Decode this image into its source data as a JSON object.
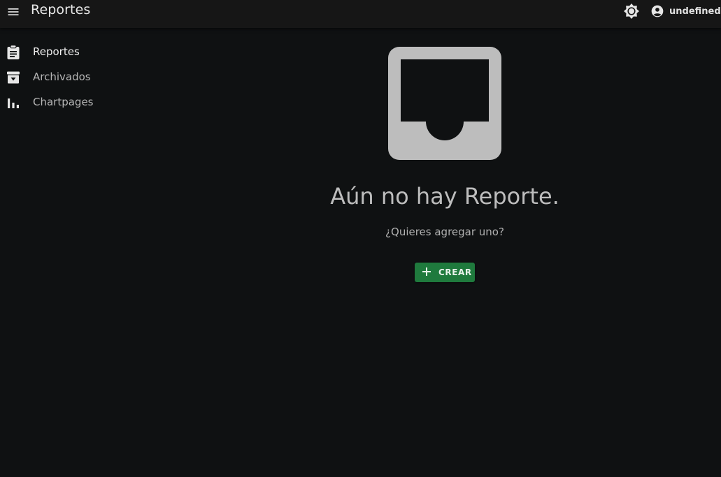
{
  "header": {
    "title": "Reportes",
    "menu_icon": "menu-icon",
    "theme_icon": "brightness-icon",
    "account_icon": "account-circle-icon",
    "user_name": "undefined"
  },
  "sidebar": {
    "items": [
      {
        "label": "Reportes",
        "icon": "clipboard-icon",
        "active": true
      },
      {
        "label": "Archivados",
        "icon": "archive-icon",
        "active": false
      },
      {
        "label": "Chartpages",
        "icon": "bar-chart-icon",
        "active": false
      }
    ]
  },
  "empty_state": {
    "icon": "inbox-icon",
    "title": "Aún no hay Reporte.",
    "subtitle": "¿Quieres agregar uno?",
    "create_label": "CREAR",
    "create_icon": "plus-icon"
  },
  "colors": {
    "background": "#0f1112",
    "topbar": "#161616",
    "primary_button": "#1f7a3d",
    "illustration": "#bdbdbd"
  }
}
